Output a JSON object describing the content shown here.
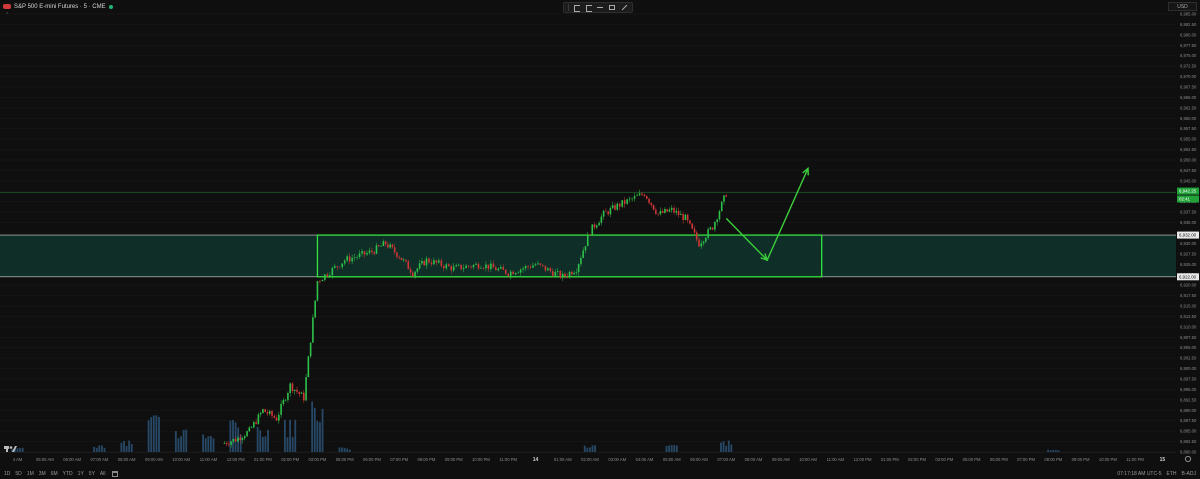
{
  "app": {
    "symbol": "S&P 500 E-mini Futures · 5 · CME",
    "currency": "USD",
    "collapse_glyph": "⌃"
  },
  "icons": [
    "flag-icon",
    "live-dot-icon",
    "vertical-bars-icon",
    "horizontal-line-icon",
    "rectangle-icon",
    "trend-line-icon",
    "calendar-icon",
    "tradingview-logo-icon",
    "settings-gear-icon"
  ],
  "colors": {
    "up": "#2ec24a",
    "down": "#d33636",
    "zone_border": "#34e33e",
    "zone_fill": "#0f3a30",
    "arrow": "#3ccd3c",
    "volume": "#2c5477",
    "grid": "#1a1a1a"
  },
  "price_axis": {
    "labels": [
      "6,985.00",
      "6,982.50",
      "6,980.00",
      "6,977.50",
      "6,975.00",
      "6,972.50",
      "6,970.00",
      "6,967.50",
      "6,965.00",
      "6,962.50",
      "6,960.00",
      "6,957.50",
      "6,955.00",
      "6,952.50",
      "6,950.00",
      "6,947.50",
      "6,945.00",
      "6,942.50",
      "6,940.00",
      "6,937.50",
      "6,935.00",
      "6,932.50",
      "6,930.00",
      "6,927.50",
      "6,925.00",
      "6,922.50",
      "6,920.00",
      "6,917.50",
      "6,915.00",
      "6,912.50",
      "6,910.00",
      "6,907.50",
      "6,905.00",
      "6,902.50",
      "6,900.00",
      "6,897.50",
      "6,895.00",
      "6,892.50",
      "6,890.00",
      "6,887.50",
      "6,885.00",
      "6,882.50",
      "6,880.00"
    ],
    "current_price": "6,942.25",
    "current_price_sub": "02:41",
    "zone_top_price": "6,932.00",
    "zone_bottom_price": "6,922.00"
  },
  "time_axis": {
    "labels": [
      "4 AM",
      "05:00 AM",
      "06:00 AM",
      "07:00 AM",
      "08:00 AM",
      "09:00 AM",
      "10:00 AM",
      "11:00 AM",
      "12:00 PM",
      "01:00 PM",
      "02:00 PM",
      "03:00 PM",
      "05:00 PM",
      "06:00 PM",
      "07:00 PM",
      "08:00 PM",
      "09:00 PM",
      "10:00 PM",
      "11:00 PM",
      "14",
      "01:00 AM",
      "02:00 AM",
      "03:00 AM",
      "04:00 AM",
      "05:00 AM",
      "06:00 AM",
      "07:00 AM",
      "08:00 AM",
      "09:00 AM",
      "10:00 AM",
      "11:00 AM",
      "12:00 PM",
      "01:00 PM",
      "02:00 PM",
      "03:00 PM",
      "05:00 PM",
      "06:00 PM",
      "07:00 PM",
      "08:00 PM",
      "09:00 PM",
      "10:00 PM",
      "11:00 PM",
      "15"
    ]
  },
  "chart_data": {
    "type": "candlestick",
    "interval": "5",
    "ylim": [
      6880,
      6985
    ],
    "support_zone": [
      6922,
      6932
    ],
    "current_price": 6942.25,
    "projection": [
      {
        "time": "07:00 AM",
        "price": 6936
      },
      {
        "time": "08:30 AM",
        "price": 6926
      },
      {
        "time": "10:00 AM",
        "price": 6948
      }
    ],
    "price_path": [
      {
        "time": "11:30 AM",
        "price": 6882
      },
      {
        "time": "12:00 PM",
        "price": 6883
      },
      {
        "time": "12:30 PM",
        "price": 6885
      },
      {
        "time": "01:00 PM",
        "price": 6890
      },
      {
        "time": "01:30 PM",
        "price": 6888
      },
      {
        "time": "02:00 PM",
        "price": 6896
      },
      {
        "time": "02:30 PM",
        "price": 6893
      },
      {
        "time": "03:00 PM",
        "price": 6921
      },
      {
        "time": "05:00 PM",
        "price": 6926
      },
      {
        "time": "06:00 PM",
        "price": 6928
      },
      {
        "time": "06:30 PM",
        "price": 6930
      },
      {
        "time": "07:00 PM",
        "price": 6927
      },
      {
        "time": "07:30 PM",
        "price": 6923
      },
      {
        "time": "08:00 PM",
        "price": 6926
      },
      {
        "time": "09:00 PM",
        "price": 6924
      },
      {
        "time": "10:00 PM",
        "price": 6925
      },
      {
        "time": "11:00 PM",
        "price": 6923
      },
      {
        "time": "14",
        "price": 6925
      },
      {
        "time": "01:00 AM",
        "price": 6922
      },
      {
        "time": "01:30 AM",
        "price": 6924
      },
      {
        "time": "02:00 AM",
        "price": 6933
      },
      {
        "time": "02:30 AM",
        "price": 6937
      },
      {
        "time": "03:00 AM",
        "price": 6939
      },
      {
        "time": "04:00 AM",
        "price": 6942
      },
      {
        "time": "04:30 AM",
        "price": 6937
      },
      {
        "time": "05:00 AM",
        "price": 6938
      },
      {
        "time": "05:30 AM",
        "price": 6936
      },
      {
        "time": "06:00 AM",
        "price": 6930
      },
      {
        "time": "06:30 AM",
        "price": 6934
      },
      {
        "time": "07:00 AM",
        "price": 6942
      }
    ],
    "volume_profile": [
      {
        "time": "4 AM",
        "volume": 2
      },
      {
        "time": "07:00 AM",
        "volume": 3
      },
      {
        "time": "08:00 AM",
        "volume": 5
      },
      {
        "time": "09:00 AM",
        "volume": 16
      },
      {
        "time": "10:00 AM",
        "volume": 10
      },
      {
        "time": "11:00 AM",
        "volume": 8
      },
      {
        "time": "12:00 PM",
        "volume": 14
      },
      {
        "time": "01:00 PM",
        "volume": 11
      },
      {
        "time": "02:00 PM",
        "volume": 14
      },
      {
        "time": "03:00 PM",
        "volume": 22
      },
      {
        "time": "05:00 PM",
        "volume": 2
      },
      {
        "time": "08:00 PM",
        "volume": 1
      },
      {
        "time": "02:00 AM",
        "volume": 3
      },
      {
        "time": "05:00 AM",
        "volume": 3
      },
      {
        "time": "07:00 AM",
        "volume": 5
      }
    ]
  },
  "bottom": {
    "ranges": [
      "1D",
      "5D",
      "1M",
      "3M",
      "6M",
      "YTD",
      "1Y",
      "5Y",
      "All"
    ],
    "clock": "07:17:18 AM UTC-5",
    "session": "ETH",
    "adjust": "B-ADJ"
  }
}
